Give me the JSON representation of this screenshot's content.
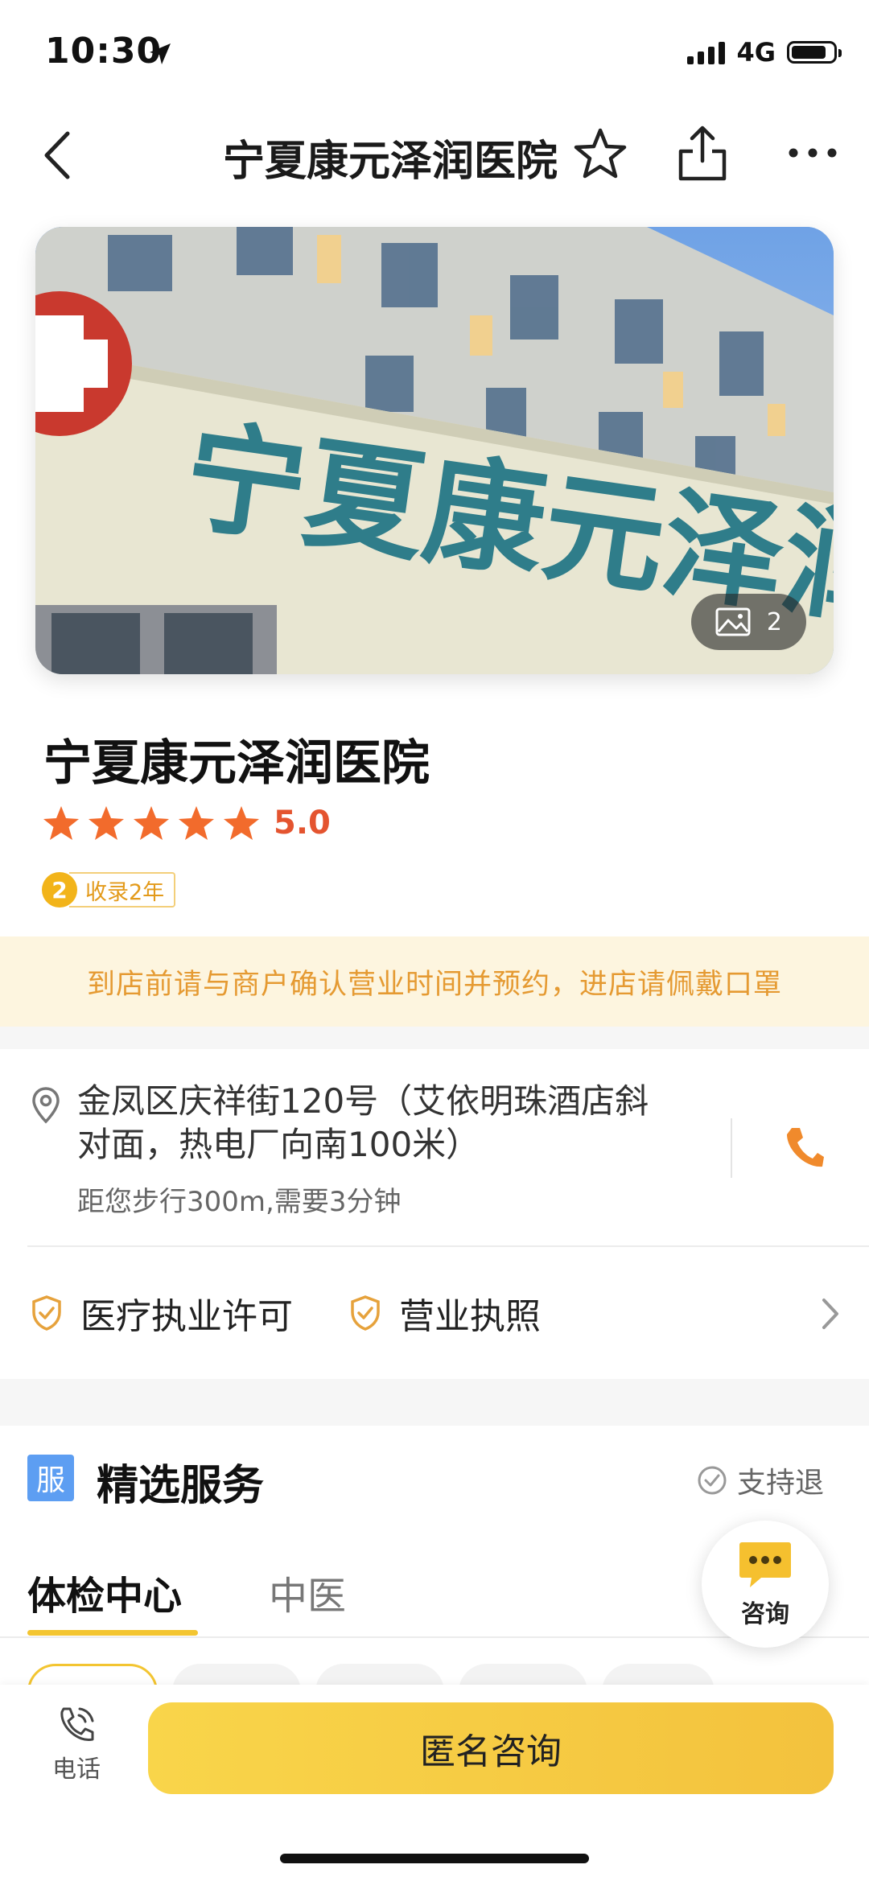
{
  "status_bar": {
    "time": "10:30",
    "network": "4G"
  },
  "nav": {
    "title": "宁夏康元泽润医院"
  },
  "hero": {
    "photo_count": "2",
    "sign_text": "宁夏康元泽润医院"
  },
  "hospital": {
    "name": "宁夏康元泽润医院",
    "rating": "5.0",
    "stars": 5,
    "badge_number": "2",
    "badge_text": "收录2年"
  },
  "notice": "到店前请与商户确认营业时间并预约，进店请佩戴口罩",
  "address": {
    "line1": "金凤区庆祥街120号（艾依明珠酒店斜",
    "line2": "对面，热电厂向南100米）",
    "walk": "距您步行300m,需要3分钟"
  },
  "licenses": {
    "medical": "医疗执业许可",
    "business": "营业执照"
  },
  "services": {
    "icon_text": "服",
    "title": "精选服务",
    "refund": "支持退",
    "tabs": [
      {
        "label": "体检中心",
        "active": true
      },
      {
        "label": "中医",
        "active": false
      }
    ]
  },
  "fab": {
    "label": "咨询"
  },
  "bottom": {
    "phone_label": "电话",
    "consult_label": "匿名咨询"
  },
  "colors": {
    "accent": "#f3c531",
    "star": "#f26b2c",
    "rating": "#e4542f",
    "notice_bg": "#fdf5df",
    "notice_text": "#e59a32",
    "phone": "#f08a2c"
  }
}
